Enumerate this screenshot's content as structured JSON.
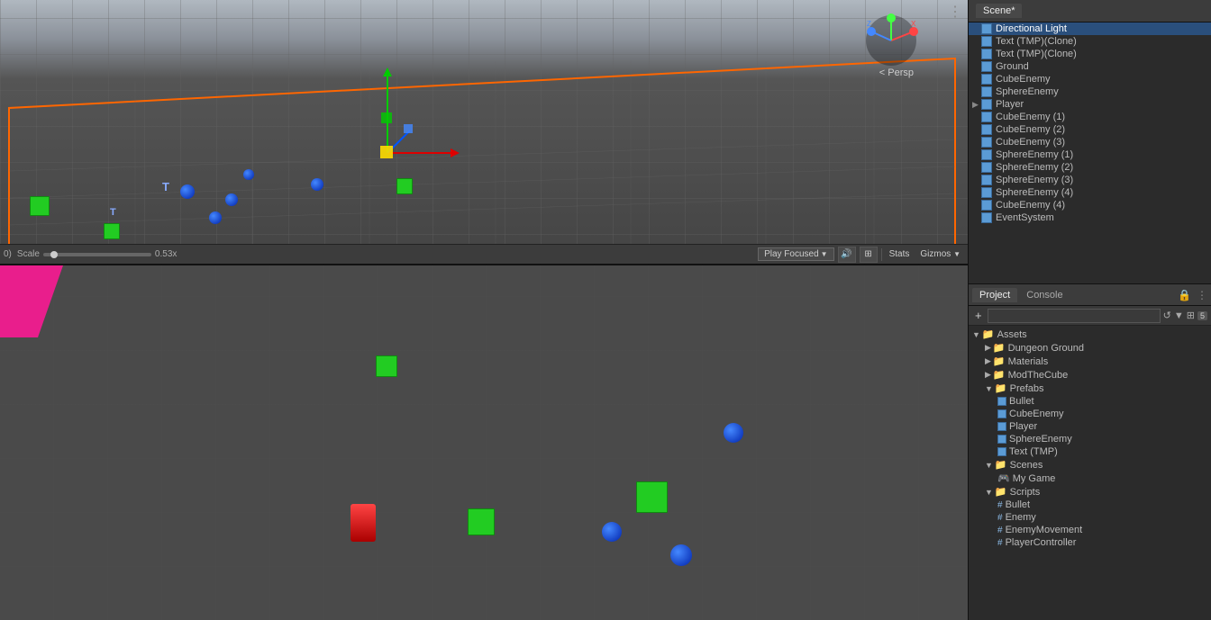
{
  "hierarchy": {
    "title": "Scene*",
    "items": [
      {
        "label": "Directional Light",
        "indent": 1,
        "type": "gameobject",
        "selected": true
      },
      {
        "label": "Text (TMP)(Clone)",
        "indent": 1,
        "type": "gameobject",
        "selected": false
      },
      {
        "label": "Text (TMP)(Clone)",
        "indent": 1,
        "type": "gameobject",
        "selected": false
      },
      {
        "label": "Ground",
        "indent": 1,
        "type": "gameobject",
        "selected": false
      },
      {
        "label": "CubeEnemy",
        "indent": 1,
        "type": "gameobject",
        "selected": false
      },
      {
        "label": "SphereEnemy",
        "indent": 1,
        "type": "gameobject",
        "selected": false
      },
      {
        "label": "Player",
        "indent": 1,
        "type": "gameobject",
        "hasArrow": true,
        "selected": false
      },
      {
        "label": "CubeEnemy (1)",
        "indent": 1,
        "type": "gameobject",
        "selected": false
      },
      {
        "label": "CubeEnemy (2)",
        "indent": 1,
        "type": "gameobject",
        "selected": false
      },
      {
        "label": "CubeEnemy (3)",
        "indent": 1,
        "type": "gameobject",
        "selected": false
      },
      {
        "label": "SphereEnemy (1)",
        "indent": 1,
        "type": "gameobject",
        "selected": false
      },
      {
        "label": "SphereEnemy (2)",
        "indent": 1,
        "type": "gameobject",
        "selected": false
      },
      {
        "label": "SphereEnemy (3)",
        "indent": 1,
        "type": "gameobject",
        "selected": false
      },
      {
        "label": "SphereEnemy (4)",
        "indent": 1,
        "type": "gameobject",
        "selected": false
      },
      {
        "label": "CubeEnemy (4)",
        "indent": 1,
        "type": "gameobject",
        "selected": false
      },
      {
        "label": "EventSystem",
        "indent": 1,
        "type": "gameobject",
        "selected": false
      }
    ]
  },
  "project_panel": {
    "tabs": [
      {
        "label": "Project",
        "active": true
      },
      {
        "label": "Console",
        "active": false
      }
    ],
    "toolbar_buttons": [
      "+",
      "🔍"
    ],
    "search_placeholder": "",
    "badge_count": "5",
    "assets": [
      {
        "label": "Assets",
        "indent": 0,
        "type": "folder",
        "expanded": true
      },
      {
        "label": "Dungeon Ground",
        "indent": 1,
        "type": "folder"
      },
      {
        "label": "Materials",
        "indent": 1,
        "type": "folder"
      },
      {
        "label": "ModTheCube",
        "indent": 1,
        "type": "folder"
      },
      {
        "label": "Prefabs",
        "indent": 1,
        "type": "folder",
        "expanded": true
      },
      {
        "label": "Bullet",
        "indent": 2,
        "type": "prefab"
      },
      {
        "label": "CubeEnemy",
        "indent": 2,
        "type": "prefab"
      },
      {
        "label": "Player",
        "indent": 2,
        "type": "prefab"
      },
      {
        "label": "SphereEnemy",
        "indent": 2,
        "type": "prefab"
      },
      {
        "label": "Text (TMP)",
        "indent": 2,
        "type": "prefab"
      },
      {
        "label": "Scenes",
        "indent": 1,
        "type": "folder",
        "expanded": true
      },
      {
        "label": "My Game",
        "indent": 2,
        "type": "scene"
      },
      {
        "label": "Scripts",
        "indent": 1,
        "type": "folder",
        "expanded": true
      },
      {
        "label": "Bullet",
        "indent": 2,
        "type": "script"
      },
      {
        "label": "Enemy",
        "indent": 2,
        "type": "script"
      },
      {
        "label": "EnemyMovement",
        "indent": 2,
        "type": "script"
      },
      {
        "label": "PlayerController",
        "indent": 2,
        "type": "script"
      }
    ]
  },
  "scene_toolbar": {
    "scale_prefix": "0)",
    "scale_label": "Scale",
    "scale_value": "0.53x",
    "play_focused_label": "Play Focused",
    "stats_label": "Stats",
    "gizmos_label": "Gizmos"
  },
  "gizmo": {
    "persp_label": "< Persp"
  }
}
